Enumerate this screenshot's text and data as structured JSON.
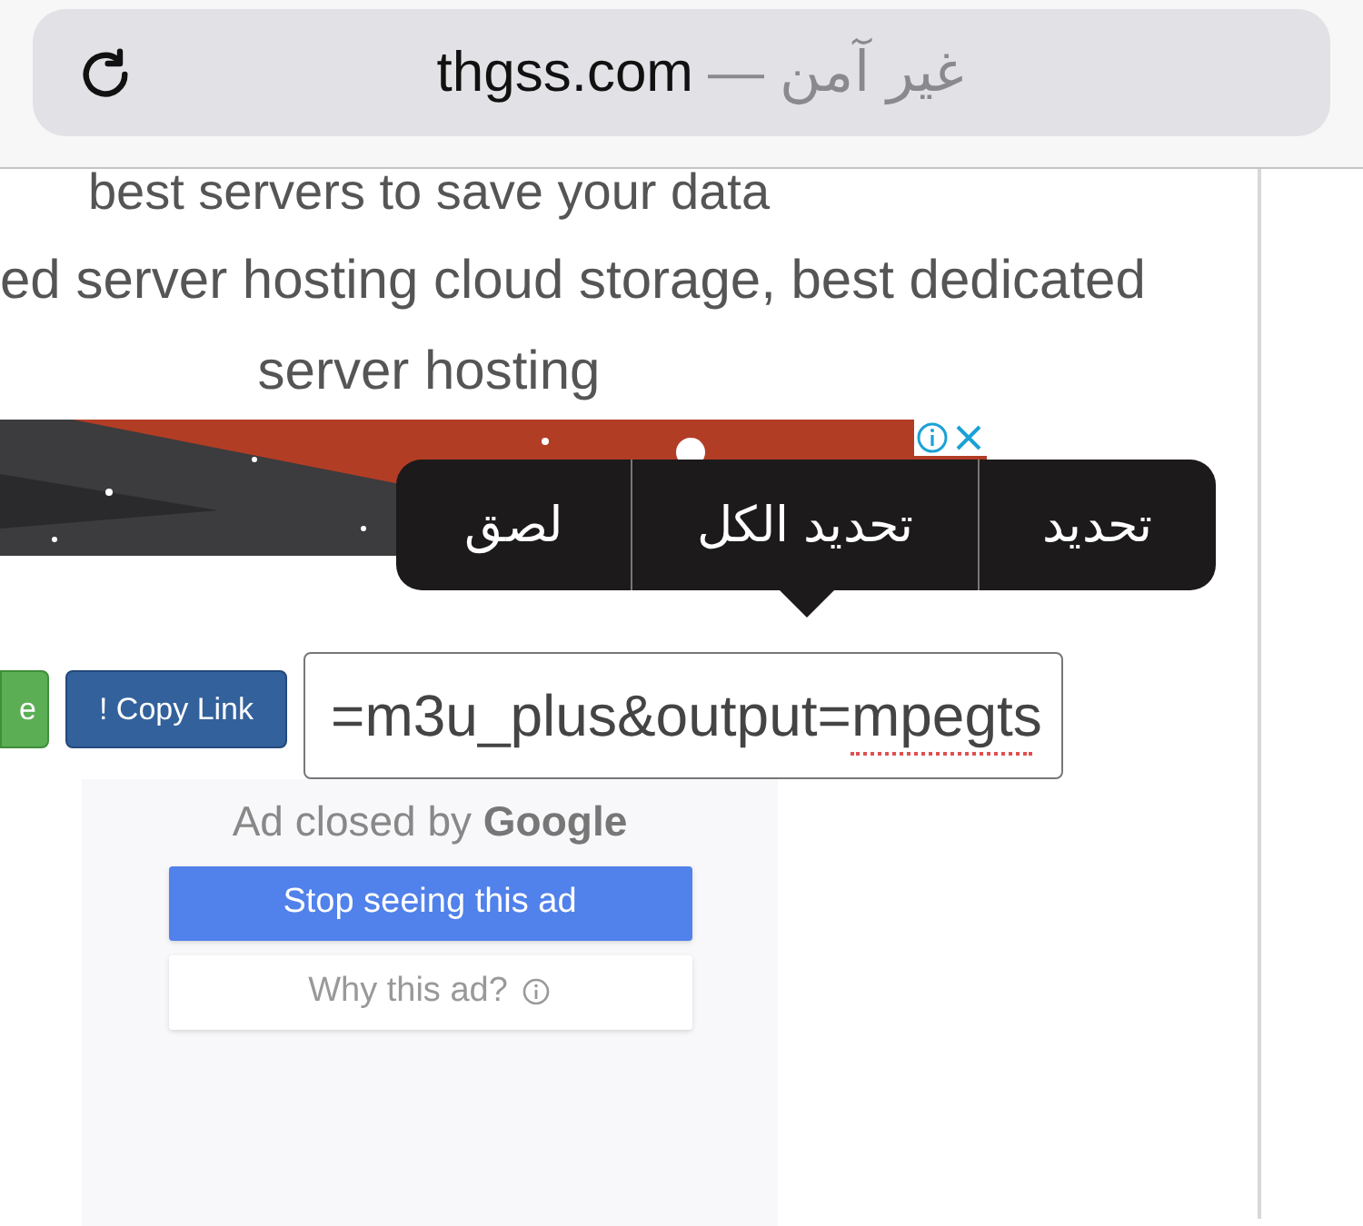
{
  "url_bar": {
    "domain": "thgss.com",
    "security": "— غير آمن"
  },
  "page_text": [
    "best servers to save your data",
    "ed server hosting cloud storage, best dedicated",
    "server hosting"
  ],
  "context_menu": {
    "items": [
      {
        "label": "تحديد"
      },
      {
        "label": "تحديد الكل"
      },
      {
        "label": "لصق"
      }
    ]
  },
  "buttons": [
    {
      "label": "e",
      "kind": "green"
    },
    {
      "label": "! Copy Link",
      "kind": "blue"
    }
  ],
  "link_field": {
    "value": "=m3u_plus&output=mpegts",
    "misspelled": true
  },
  "ad_closed": {
    "title": "Ad closed by **Google**",
    "stop_button": "Stop seeing this ad",
    "why_button": "Why this ad?"
  }
}
